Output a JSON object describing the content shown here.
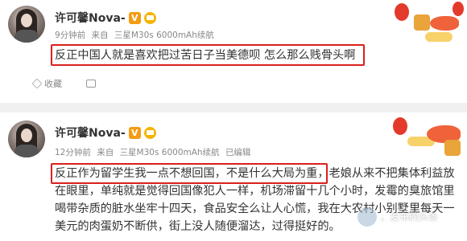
{
  "posts": [
    {
      "username": "许可馨Nova-",
      "badge_v": "V",
      "meta_time": "9分钟前",
      "meta_from": "来自",
      "meta_device": "三星M30s 6000mAh续航",
      "text": "反正中国人就是喜欢把过苦日子当美德呗 怎么那么贱骨头啊",
      "actions": [
        {
          "label": "收藏",
          "icon": "star-icon"
        },
        {
          "label": "",
          "icon": "share-icon"
        }
      ]
    },
    {
      "username": "许可馨Nova-",
      "badge_v": "V",
      "meta_time": "12分钟前",
      "meta_from": "来自",
      "meta_device": "三星M30s 6000mAh续航",
      "meta_edited": "已编辑",
      "text_highlight": "反正作为留学生我一点不想回国，不是什么大局为重，",
      "text_rest": "老娘从来不把集体利益放在眼里，单纯就是觉得回国像犯人一样，机场滞留十几个小时，发霉的臭旅馆里喝带杂质的脏水坐牢十四天，食品安全么让人心慌，我在大农村小别墅里每天一美元的肉蛋奶不断供，街上没人随便溜达，过得挺好的。"
    }
  ],
  "watermark_text": "，发布的头条",
  "colors": {
    "highlight_box": "#d9201c",
    "meta": "#888888",
    "vip": "#f39c12"
  }
}
